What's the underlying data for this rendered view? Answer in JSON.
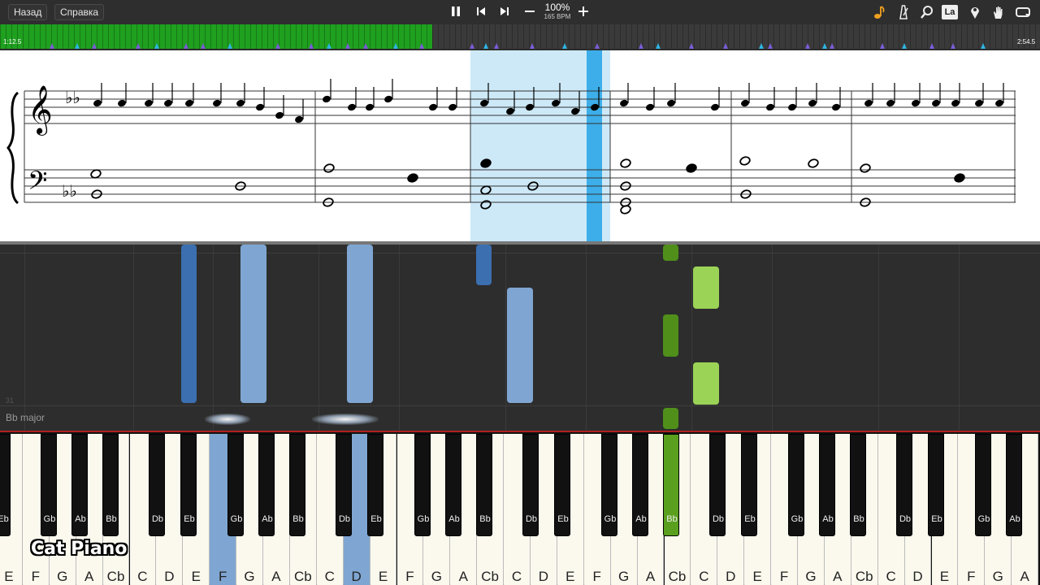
{
  "toolbar": {
    "back_label": "Назад",
    "help_label": "Справка",
    "zoom_percent": "100%",
    "bpm": "165 BPM",
    "icons": [
      "pause-icon",
      "skip-back-icon",
      "skip-forward-icon",
      "minus-icon",
      "plus-icon",
      "music-note-icon",
      "metronome-icon",
      "search-icon",
      "la-icon",
      "marker-icon",
      "hand-icon",
      "loop-icon"
    ],
    "la_label": "La"
  },
  "timeline": {
    "current_time": "1:12.5",
    "total_time": "2:54.5",
    "progress": 0.415,
    "colors": {
      "played": "#1fa01f",
      "purple_marker": "#7a5cd6",
      "cyan_marker": "#2eb4e0"
    }
  },
  "sheet": {
    "key_signature": "Bb major",
    "highlight_color": "#cde9f8",
    "cursor_color": "#3daee9"
  },
  "waterfall": {
    "key_label": "Bb major",
    "measure_number": "31",
    "colors": {
      "left_hand": "#7fa6d2",
      "left_hand_dark": "#3b6fb0",
      "right_hand": "#9ad356",
      "right_hand_dark": "#4f8f1a"
    }
  },
  "keyboard": {
    "white_keys": [
      "E",
      "F",
      "G",
      "A",
      "Cb",
      "C",
      "D",
      "E",
      "F",
      "G",
      "A",
      "Cb",
      "C",
      "D",
      "E",
      "F",
      "G",
      "A",
      "Cb",
      "C",
      "D",
      "E",
      "F",
      "G",
      "A",
      "Cb",
      "C",
      "D",
      "E",
      "F",
      "G",
      "A",
      "Cb",
      "C",
      "D",
      "E",
      "F",
      "G",
      "A"
    ],
    "black_keys": [
      "Eb",
      "Gb",
      "Ab",
      "Bb",
      "Db",
      "Eb",
      "Gb",
      "Ab",
      "Bb",
      "Db",
      "Eb",
      "Gb",
      "Ab",
      "Bb",
      "Db",
      "Eb",
      "Gb",
      "Ab",
      "Bb",
      "Db",
      "Eb",
      "Gb",
      "Ab",
      "Bb",
      "Db",
      "Eb",
      "Gb",
      "Ab"
    ],
    "pressed_white": [
      "F",
      "D"
    ],
    "pressed_black": [
      "Bb"
    ]
  },
  "brand": "Cat Piano"
}
